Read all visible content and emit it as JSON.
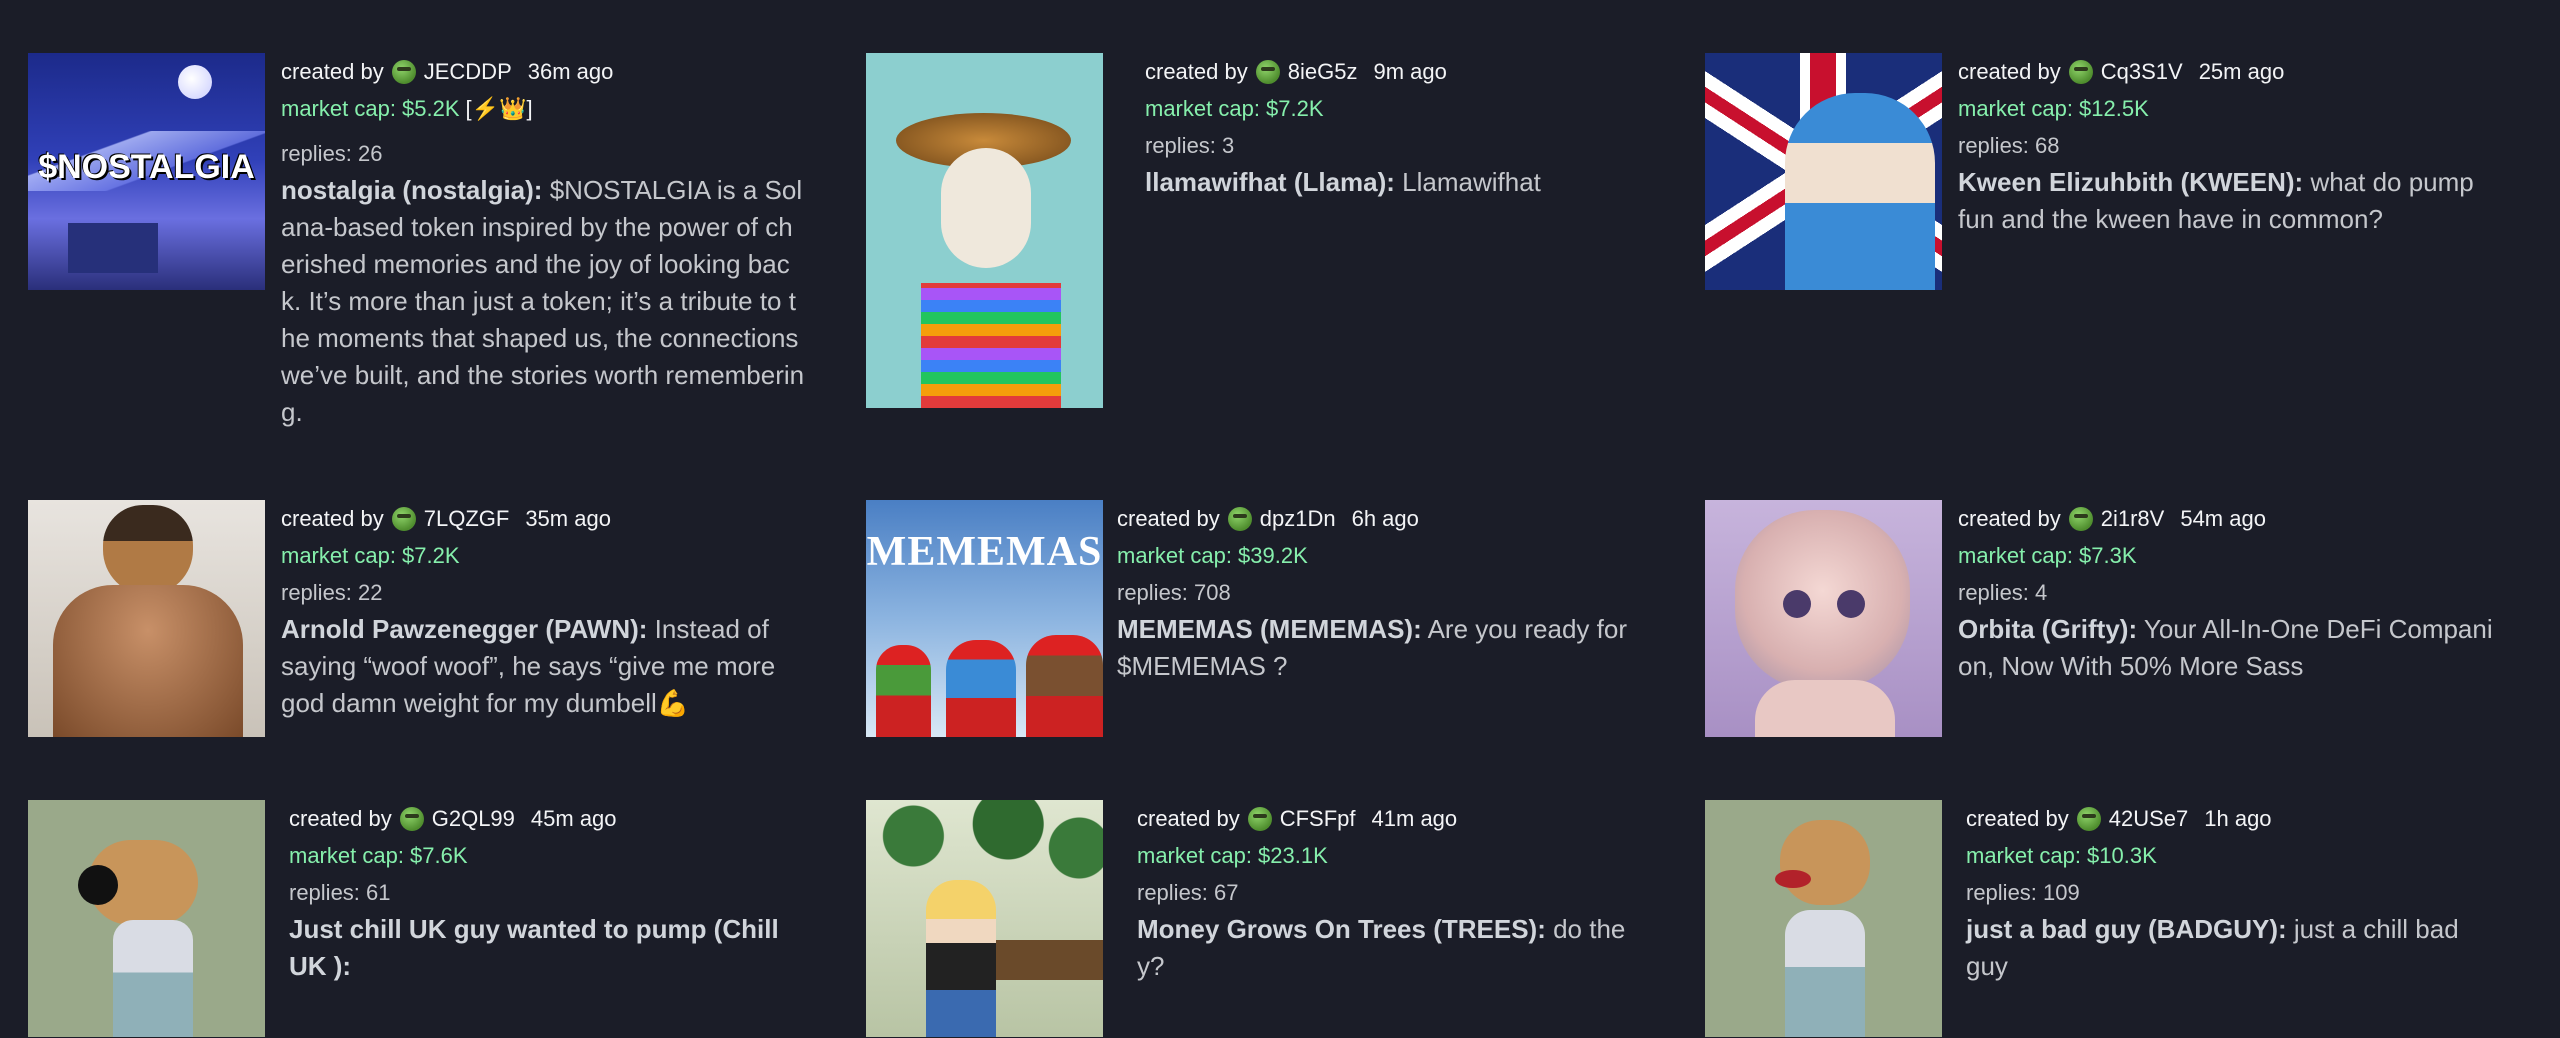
{
  "cards": [
    {
      "user": "JECDDP",
      "age": "36m ago",
      "mcap": "market cap: $5.2K",
      "has_badge": true,
      "replies": "replies: 26",
      "title": "nostalgia (nostalgia):",
      "desc": "$NOSTALGIA is a Solana-based token inspired by the power of cherished memories and the joy of looking back. It’s more than just a token; it’s a tribute to the moments that shaped us, the connections we’ve built, and the stories worth remembering.",
      "thumb_text": "$NOSTALGIA",
      "created": "created by"
    },
    {
      "user": "8ieG5z",
      "age": "9m ago",
      "mcap": "market cap: $7.2K",
      "replies": "replies: 3",
      "title": "llamawifhat (Llama):",
      "desc": "Llamawifhat",
      "created": "created by"
    },
    {
      "user": "Cq3S1V",
      "age": "25m ago",
      "mcap": "market cap: $12.5K",
      "replies": "replies: 68",
      "title": "Kween Elizuhbith (KWEEN):",
      "desc": "what do pump fun and the kween have in common?",
      "created": "created by"
    },
    {
      "user": "7LQZGF",
      "age": "35m ago",
      "mcap": "market cap: $7.2K",
      "replies": "replies: 22",
      "title": "Arnold Pawzenegger (PAWN):",
      "desc": "Instead of saying “woof woof”, he says “give me more god damn weight for my dumbell💪",
      "created": "created by"
    },
    {
      "user": "dpz1Dn",
      "age": "6h ago",
      "mcap": "market cap: $39.2K",
      "replies": "replies: 708",
      "title": "MEMEMAS (MEMEMAS):",
      "desc": "Are you ready for $MEMEMAS ?",
      "thumb_text": "MEMEMAS",
      "created": "created by"
    },
    {
      "user": "2i1r8V",
      "age": "54m ago",
      "mcap": "market cap: $7.3K",
      "replies": "replies: 4",
      "title": "Orbita (Grifty):",
      "desc": "Your All-In-One DeFi Companion, Now With 50% More Sass",
      "created": "created by"
    },
    {
      "user": "G2QL99",
      "age": "45m ago",
      "mcap": "market cap: $7.6K",
      "replies": "replies: 61",
      "title": "Just chill UK guy wanted to pump (Chill UK ):",
      "desc": "",
      "created": "created by"
    },
    {
      "user": "CFSFpf",
      "age": "41m ago",
      "mcap": "market cap: $23.1K",
      "replies": "replies: 67",
      "title": "Money Grows On Trees (TREES):",
      "desc": "do they?",
      "created": "created by"
    },
    {
      "user": "42USe7",
      "age": "1h ago",
      "mcap": "market cap: $10.3K",
      "replies": "replies: 109",
      "title": "just a bad guy (BADGUY):",
      "desc": "just a chill bad guy",
      "created": "created by"
    }
  ],
  "badge_text": "[⚡👑]",
  "colors": {
    "background": "#1b1d28",
    "market_cap": "#86efac",
    "text": "#f3f4f6",
    "muted": "#c5c7cc"
  }
}
